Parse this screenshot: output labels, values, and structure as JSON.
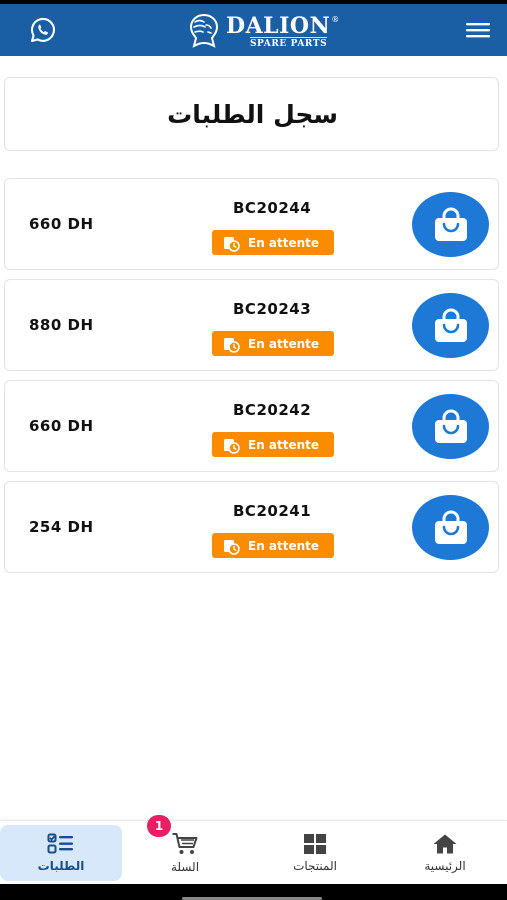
{
  "header": {
    "brand_name": "DALION",
    "brand_sub": "SPARE PARTS",
    "brand_mark": "®",
    "whatsapp_icon": "whatsapp-icon",
    "menu_icon": "hamburger-menu-icon",
    "color": "#1a5ea3"
  },
  "page": {
    "title": "سجل الطلبات"
  },
  "orders": [
    {
      "ref": "BC20244",
      "amount": "660 DH",
      "status": "En attente"
    },
    {
      "ref": "BC20243",
      "amount": "880 DH",
      "status": "En attente"
    },
    {
      "ref": "BC20242",
      "amount": "660 DH",
      "status": "En attente"
    },
    {
      "ref": "BC20241",
      "amount": "254 DH",
      "status": "En attente"
    }
  ],
  "colors": {
    "status_pending": "#fb8c00",
    "order_icon_bg": "#1e79d6",
    "active_tab_bg": "#d6e8fa",
    "cart_badge": "#e91e63"
  },
  "nav": {
    "orders": {
      "label": "الطلبات",
      "icon": "checklist-icon"
    },
    "cart": {
      "label": "السلة",
      "icon": "cart-icon",
      "badge": "1"
    },
    "products": {
      "label": "المنتجات",
      "icon": "grid-icon"
    },
    "home": {
      "label": "الرئيسية",
      "icon": "home-icon"
    }
  }
}
